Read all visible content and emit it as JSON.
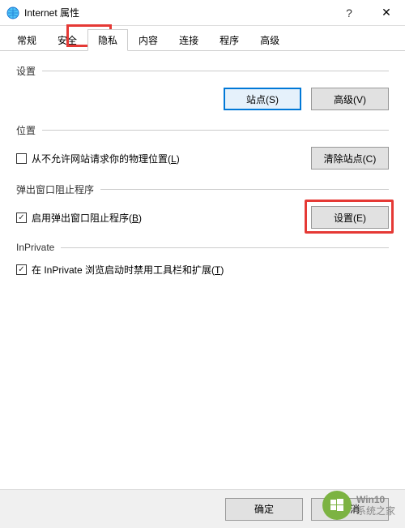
{
  "window": {
    "title": "Internet 属性",
    "help": "?",
    "close": "✕"
  },
  "tabs": {
    "t0": "常规",
    "t1": "安全",
    "t2": "隐私",
    "t3": "内容",
    "t4": "连接",
    "t5": "程序",
    "t6": "高级"
  },
  "sections": {
    "settings": "设置",
    "location": "位置",
    "popup": "弹出窗口阻止程序",
    "inprivate": "InPrivate"
  },
  "buttons": {
    "sites": "站点(S)",
    "advanced": "高级(V)",
    "clear_sites": "清除站点(C)",
    "settings_e": "设置(E)",
    "ok": "确定",
    "cancel": "取消"
  },
  "checkboxes": {
    "location_label_pre": "从不允许网站请求你的物理位置(",
    "location_label_u": "L",
    "location_label_post": ")",
    "popup_label_pre": "启用弹出窗口阻止程序(",
    "popup_label_u": "B",
    "popup_label_post": ")",
    "inprivate_label_pre": "在 InPrivate 浏览启动时禁用工具栏和扩展(",
    "inprivate_label_u": "T",
    "inprivate_label_post": ")"
  },
  "watermark": {
    "line1": "Win10",
    "line2": "系统之家"
  }
}
